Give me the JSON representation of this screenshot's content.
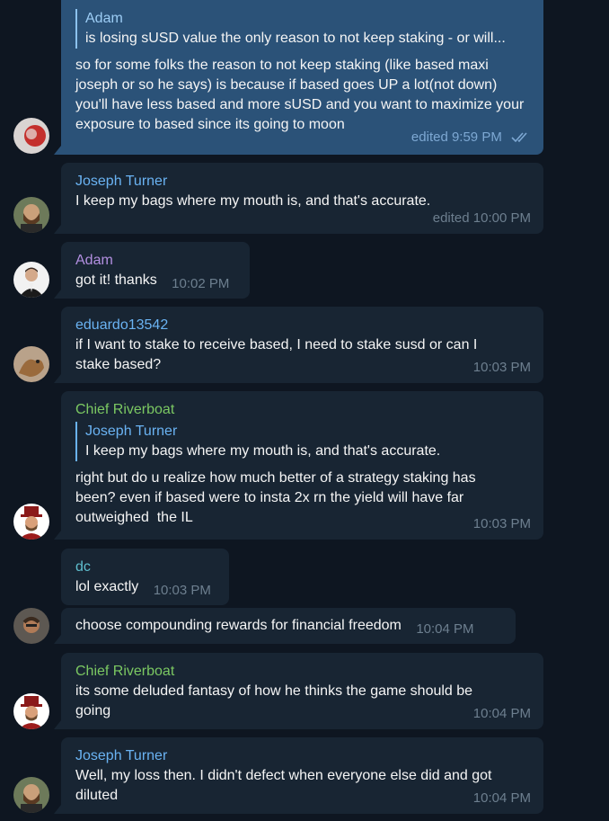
{
  "messages": [
    {
      "reply_to": {
        "name": "Adam",
        "text": "is losing sUSD value the only reason to not keep staking - or will..."
      },
      "text": "so for some folks the reason to not keep staking (like based maxi joseph or so he says) is because if based goes UP a lot(not down) you'll have less based and more sUSD and you want to maximize your exposure to based since its going to moon",
      "time": "edited 9:59 PM",
      "read_icon": "double-check-icon"
    },
    {
      "sender": "Joseph Turner",
      "sender_color": "#6ab3f3",
      "text": "I keep my bags where my mouth is, and that's accurate.",
      "time": "edited 10:00 PM"
    },
    {
      "sender": "Adam",
      "sender_color": "#b28fe0",
      "text": "got it! thanks",
      "time": "10:02 PM"
    },
    {
      "sender": "eduardo13542",
      "sender_color": "#6ab3f3",
      "text": "if I want to stake to receive based, I need to stake susd or can I stake based?",
      "time": "10:03 PM"
    },
    {
      "sender": "Chief Riverboat",
      "sender_color": "#7bc862",
      "reply_to": {
        "name": "Joseph Turner",
        "text": "I keep my bags where my mouth is, and that's accurate."
      },
      "text": "right but do u realize how much better of a strategy staking has been? even if based were to insta 2x rn the yield will have far outweighed  the IL",
      "time": "10:03 PM"
    },
    {
      "sender": "dc",
      "sender_color": "#5fbfcf",
      "text": "lol exactly",
      "time": "10:03 PM"
    },
    {
      "text": "choose compounding rewards for financial freedom",
      "time": "10:04 PM"
    },
    {
      "sender": "Chief Riverboat",
      "sender_color": "#7bc862",
      "text": "its some deluded fantasy of how he thinks the game should be going",
      "time": "10:04 PM"
    },
    {
      "sender": "Joseph Turner",
      "sender_color": "#6ab3f3",
      "text": "Well, my loss then. I didn't defect when everyone else did and got diluted",
      "time": "10:04 PM"
    }
  ]
}
